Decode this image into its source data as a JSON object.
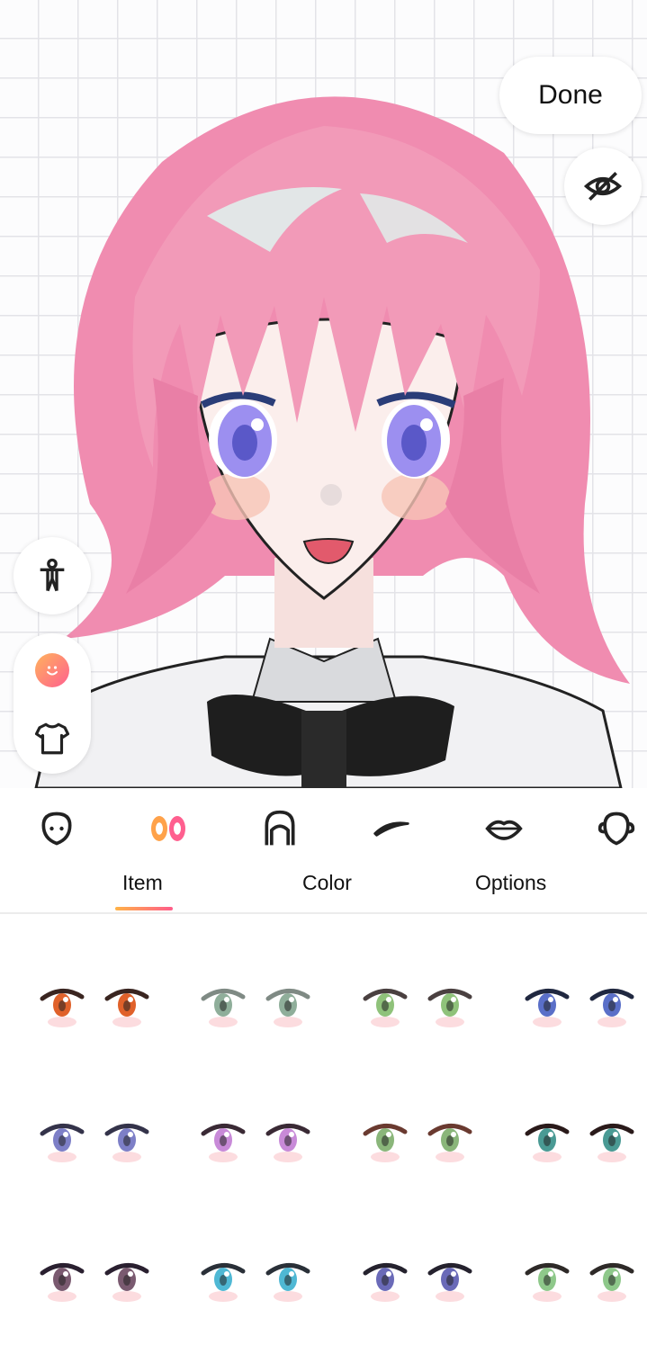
{
  "toolbar": {
    "done_label": "Done"
  },
  "side_tools": {
    "hide_icon": "eye-slash-icon",
    "pose_icon": "person-pose-icon",
    "face_icon": "smiley-face-icon",
    "clothing_icon": "shirt-icon"
  },
  "categories": [
    {
      "icon": "face-shape-icon"
    },
    {
      "icon": "eyes-icon",
      "selected": true
    },
    {
      "icon": "hair-icon"
    },
    {
      "icon": "eyebrow-icon"
    },
    {
      "icon": "lips-icon"
    },
    {
      "icon": "ears-icon"
    }
  ],
  "tabs": [
    {
      "label": "Item",
      "selected": true
    },
    {
      "label": "Color"
    },
    {
      "label": "Options"
    }
  ],
  "colors": {
    "accent_start": "#ffb347",
    "accent_end": "#ff5c8a",
    "hair": "#f08cb0",
    "grid_line": "#e3e3e8"
  },
  "eye_items": [
    {
      "iris": "#e0612a",
      "lash": "#3a2520"
    },
    {
      "iris": "#8fae9a",
      "lash": "#7f8a84"
    },
    {
      "iris": "#8fc27a",
      "lash": "#4a4040"
    },
    {
      "iris": "#5a6fc8",
      "lash": "#202840"
    },
    {
      "iris": "#7d7fc7",
      "lash": "#34334a"
    },
    {
      "iris": "#c88ad8",
      "lash": "#3a2a35"
    },
    {
      "iris": "#8ab67a",
      "lash": "#6a3a30"
    },
    {
      "iris": "#4a9a94",
      "lash": "#2a1a1a"
    },
    {
      "iris": "#7a5a70",
      "lash": "#2a2030"
    },
    {
      "iris": "#4fb8d4",
      "lash": "#2a3038"
    },
    {
      "iris": "#6a6ab8",
      "lash": "#25222e"
    },
    {
      "iris": "#8ec88a",
      "lash": "#2e2a28"
    }
  ]
}
